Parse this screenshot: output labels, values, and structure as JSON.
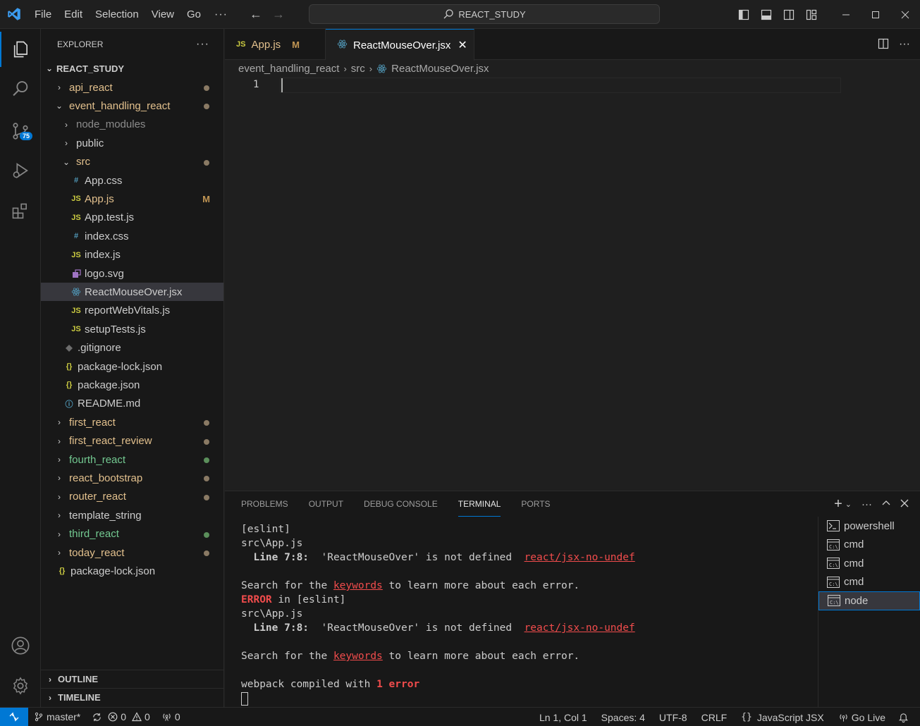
{
  "menu": [
    "File",
    "Edit",
    "Selection",
    "View",
    "Go"
  ],
  "command_center": "REACT_STUDY",
  "activity": {
    "source_control_badge": "75"
  },
  "explorer": {
    "header": "EXPLORER",
    "root": "REACT_STUDY",
    "rows": [
      {
        "label": "api_react",
        "kind": "folder",
        "depth": 0,
        "open": false,
        "color": "yellow",
        "dot": "brown"
      },
      {
        "label": "event_handling_react",
        "kind": "folder",
        "depth": 0,
        "open": true,
        "color": "yellow",
        "dot": "brown"
      },
      {
        "label": "node_modules",
        "kind": "folder",
        "depth": 1,
        "open": false,
        "color": "dim"
      },
      {
        "label": "public",
        "kind": "folder",
        "depth": 1,
        "open": false,
        "color": "normal"
      },
      {
        "label": "src",
        "kind": "folder",
        "depth": 1,
        "open": true,
        "color": "yellow",
        "dot": "brown"
      },
      {
        "label": "App.css",
        "kind": "css",
        "depth": 2,
        "color": "normal"
      },
      {
        "label": "App.js",
        "kind": "js",
        "depth": 2,
        "color": "yellow",
        "mark": "M"
      },
      {
        "label": "App.test.js",
        "kind": "js",
        "depth": 2,
        "color": "normal"
      },
      {
        "label": "index.css",
        "kind": "css",
        "depth": 2,
        "color": "normal"
      },
      {
        "label": "index.js",
        "kind": "js",
        "depth": 2,
        "color": "normal"
      },
      {
        "label": "logo.svg",
        "kind": "svg",
        "depth": 2,
        "color": "normal"
      },
      {
        "label": "ReactMouseOver.jsx",
        "kind": "react",
        "depth": 2,
        "color": "normal",
        "selected": true
      },
      {
        "label": "reportWebVitals.js",
        "kind": "js",
        "depth": 2,
        "color": "normal"
      },
      {
        "label": "setupTests.js",
        "kind": "js",
        "depth": 2,
        "color": "normal"
      },
      {
        "label": ".gitignore",
        "kind": "git",
        "depth": 1,
        "color": "normal"
      },
      {
        "label": "package-lock.json",
        "kind": "json",
        "depth": 1,
        "color": "normal"
      },
      {
        "label": "package.json",
        "kind": "json",
        "depth": 1,
        "color": "normal"
      },
      {
        "label": "README.md",
        "kind": "info",
        "depth": 1,
        "color": "normal"
      },
      {
        "label": "first_react",
        "kind": "folder",
        "depth": 0,
        "open": false,
        "color": "yellow",
        "dot": "brown"
      },
      {
        "label": "first_react_review",
        "kind": "folder",
        "depth": 0,
        "open": false,
        "color": "yellow",
        "dot": "brown"
      },
      {
        "label": "fourth_react",
        "kind": "folder",
        "depth": 0,
        "open": false,
        "color": "green",
        "dot": "green"
      },
      {
        "label": "react_bootstrap",
        "kind": "folder",
        "depth": 0,
        "open": false,
        "color": "yellow",
        "dot": "brown"
      },
      {
        "label": "router_react",
        "kind": "folder",
        "depth": 0,
        "open": false,
        "color": "yellow",
        "dot": "brown"
      },
      {
        "label": "template_string",
        "kind": "folder",
        "depth": 0,
        "open": false,
        "color": "normal"
      },
      {
        "label": "third_react",
        "kind": "folder",
        "depth": 0,
        "open": false,
        "color": "green",
        "dot": "green"
      },
      {
        "label": "today_react",
        "kind": "folder",
        "depth": 0,
        "open": false,
        "color": "yellow",
        "dot": "brown"
      },
      {
        "label": "package-lock.json",
        "kind": "json",
        "depth": 0,
        "color": "normal"
      }
    ],
    "outline": "OUTLINE",
    "timeline": "TIMELINE"
  },
  "tabs": [
    {
      "label": "App.js",
      "icon": "JS",
      "mark": "M",
      "active": false
    },
    {
      "label": "ReactMouseOver.jsx",
      "icon": "react",
      "active": true
    }
  ],
  "breadcrumb": [
    "event_handling_react",
    "src",
    "ReactMouseOver.jsx"
  ],
  "editor": {
    "line_number": "1"
  },
  "panel": {
    "tabs": [
      "PROBLEMS",
      "OUTPUT",
      "DEBUG CONSOLE",
      "TERMINAL",
      "PORTS"
    ],
    "active_tab": "TERMINAL",
    "terminal": {
      "l1": "[eslint]",
      "l2": "src\\App.js",
      "l3_pos": "  Line 7:8:",
      "l3_msg": "  'ReactMouseOver' is not defined  ",
      "l3_rule": "react/jsx-no-undef",
      "l5_pre": "Search for the ",
      "l5_link": "keywords",
      "l5_post": " to learn more about each error.",
      "l6_err": "ERROR",
      "l6_rest": " in [eslint]",
      "l7": "src\\App.js",
      "l8_pos": "  Line 7:8:",
      "l8_msg": "  'ReactMouseOver' is not defined  ",
      "l8_rule": "react/jsx-no-undef",
      "l10_pre": "Search for the ",
      "l10_link": "keywords",
      "l10_post": " to learn more about each error.",
      "l12_pre": "webpack compiled with ",
      "l12_err": "1 error"
    },
    "terminals": [
      {
        "label": "powershell",
        "icon": "powershell"
      },
      {
        "label": "cmd",
        "icon": "cmd"
      },
      {
        "label": "cmd",
        "icon": "cmd"
      },
      {
        "label": "cmd",
        "icon": "cmd"
      },
      {
        "label": "node",
        "icon": "cmd",
        "selected": true
      }
    ]
  },
  "status": {
    "branch": "master*",
    "errors": "0",
    "warnings": "0",
    "ports": "0",
    "position": "Ln 1, Col 1",
    "spaces": "Spaces: 4",
    "encoding": "UTF-8",
    "eol": "CRLF",
    "language": "JavaScript JSX",
    "golive": "Go Live"
  },
  "colors": {
    "accent": "#0078d4",
    "modified": "#e2c08d",
    "untracked": "#73c991",
    "error": "#f14c4c"
  }
}
